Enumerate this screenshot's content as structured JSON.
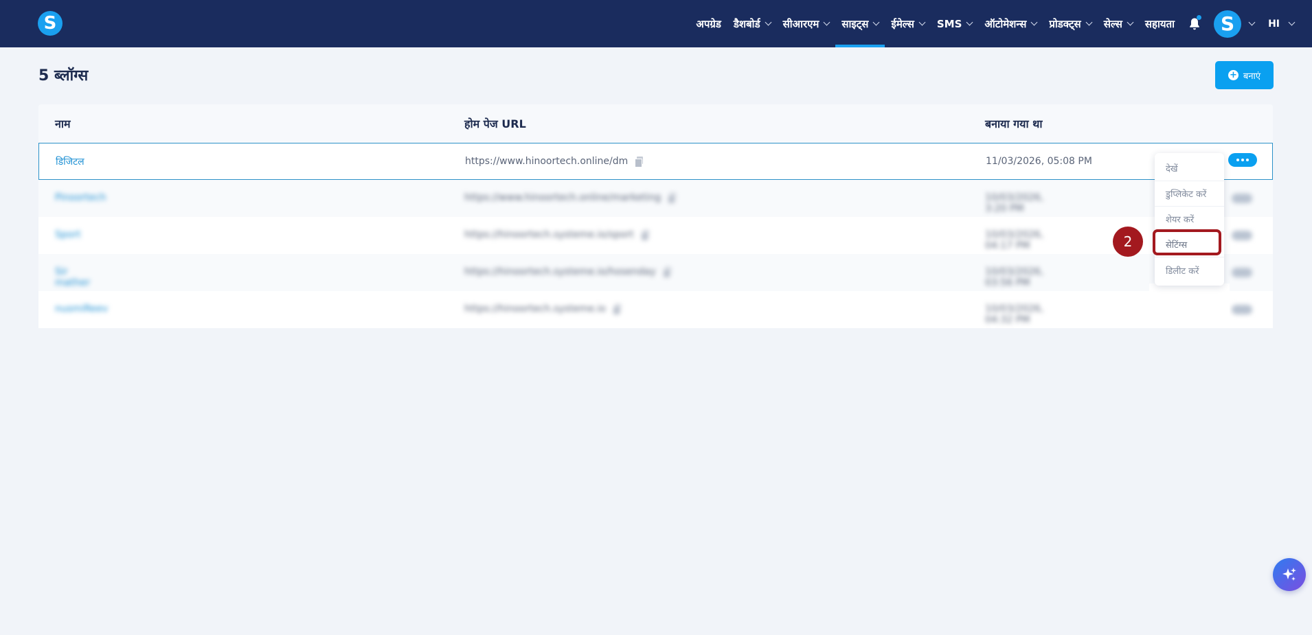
{
  "app": {
    "logo_letter": "S"
  },
  "nav": {
    "items": [
      {
        "label": "अपग्रेड",
        "has_chevron": false,
        "active": false
      },
      {
        "label": "डैशबोर्ड",
        "has_chevron": true,
        "active": false
      },
      {
        "label": "सीआरएम",
        "has_chevron": true,
        "active": false
      },
      {
        "label": "साइट्स",
        "has_chevron": true,
        "active": true
      },
      {
        "label": "ईमेल्स",
        "has_chevron": true,
        "active": false
      },
      {
        "label": "SMS",
        "has_chevron": true,
        "active": false
      },
      {
        "label": "ऑटोमेशन्स",
        "has_chevron": true,
        "active": false
      },
      {
        "label": "प्रोडक्ट्स",
        "has_chevron": true,
        "active": false
      },
      {
        "label": "सेल्स",
        "has_chevron": true,
        "active": false
      },
      {
        "label": "सहायता",
        "has_chevron": false,
        "active": false
      }
    ],
    "avatar_letter": "S",
    "language": "HI"
  },
  "page": {
    "title": "5 ब्लॉग्स",
    "create_button_label": "बनाएं"
  },
  "table": {
    "columns": [
      "नाम",
      "होम पेज URL",
      "बनाया गया था"
    ],
    "rows": [
      {
        "name": "डिजिटल",
        "url": "https://www.hinoortech.online/dm",
        "created": "11/03/2026, 05:08 PM",
        "blurred": false
      },
      {
        "name": "Pinoortech",
        "url": "https://www.hinoortech.online/marketing",
        "created": "10/03/2026, 3:20 PM",
        "blurred": true
      },
      {
        "name": "Sport",
        "url": "https://hinoortech.systeme.io/sport",
        "created": "10/03/2026, 04:17 PM",
        "blurred": true
      },
      {
        "name": "Sir mather",
        "url": "https://hinoortech.systeme.io/hosenday",
        "created": "10/03/2026, 03:56 PM",
        "blurred": true
      },
      {
        "name": "nusmiReev",
        "url": "https://hinoortech.systeme.io",
        "created": "10/03/2026, 04:32 PM",
        "blurred": true
      }
    ]
  },
  "row_menu": {
    "items": [
      "देखें",
      "डुप्लिकेट करें",
      "शेयर करें",
      "सेटिंग्स",
      "डिलीट करें"
    ],
    "highlighted_index": 3
  },
  "annotation": {
    "step_number": "2"
  },
  "colors": {
    "topbar": "#1a2c5e",
    "accent": "#0aa0f0",
    "link": "#1c8fd3",
    "annotation_red": "#a3191f",
    "page_bg": "#f1f4f9"
  },
  "icons": {
    "notification": "bell-icon",
    "create": "plus-circle-icon",
    "copy": "copy-icon",
    "more": "more-dots-icon",
    "ai_assistant": "sparkle-icon"
  }
}
